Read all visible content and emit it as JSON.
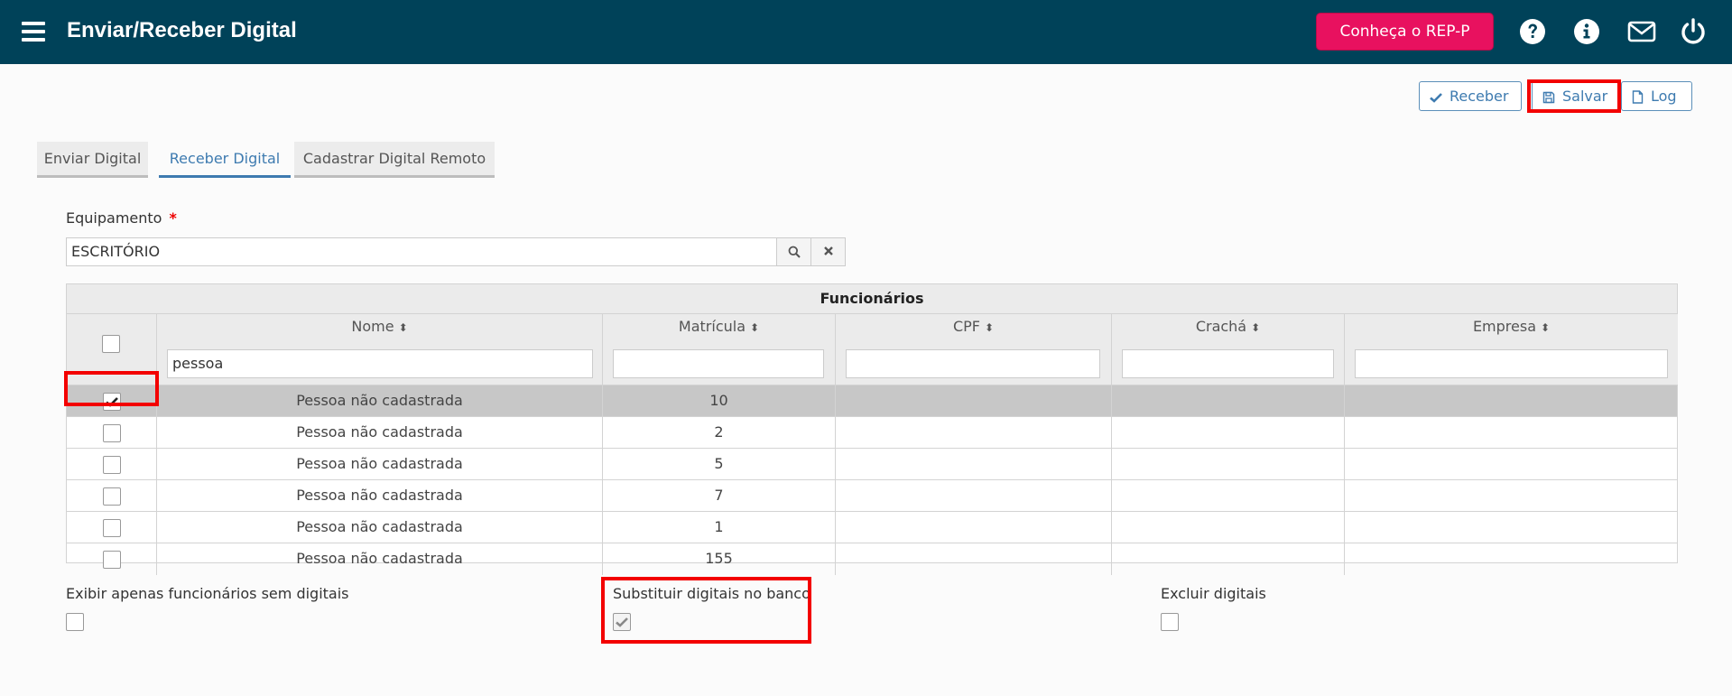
{
  "header": {
    "title": "Enviar/Receber Digital",
    "rep_button": "Conheça o REP-P",
    "icons": [
      "menu-icon",
      "help-icon",
      "info-icon",
      "mail-icon",
      "power-icon"
    ]
  },
  "toolbar": {
    "receber": "Receber",
    "salvar": "Salvar",
    "log": "Log"
  },
  "tabs": [
    {
      "label": "Enviar Digital",
      "active": false
    },
    {
      "label": "Receber Digital",
      "active": true
    },
    {
      "label": "Cadastrar Digital Remoto",
      "active": false
    }
  ],
  "form": {
    "equipamento_label": "Equipamento",
    "required_mark": "*",
    "equipamento_value": "ESCRITÓRIO"
  },
  "table": {
    "caption": "Funcionários",
    "columns": [
      "Nome",
      "Matrícula",
      "CPF",
      "Crachá",
      "Empresa"
    ],
    "filters": {
      "nome": "pessoa",
      "matricula": "",
      "cpf": "",
      "cracha": "",
      "empresa": ""
    },
    "rows": [
      {
        "checked": true,
        "nome": "Pessoa não cadastrada",
        "matricula": "10",
        "cpf": "",
        "cracha": "",
        "empresa": ""
      },
      {
        "checked": false,
        "nome": "Pessoa não cadastrada",
        "matricula": "2",
        "cpf": "",
        "cracha": "",
        "empresa": ""
      },
      {
        "checked": false,
        "nome": "Pessoa não cadastrada",
        "matricula": "5",
        "cpf": "",
        "cracha": "",
        "empresa": ""
      },
      {
        "checked": false,
        "nome": "Pessoa não cadastrada",
        "matricula": "7",
        "cpf": "",
        "cracha": "",
        "empresa": ""
      },
      {
        "checked": false,
        "nome": "Pessoa não cadastrada",
        "matricula": "1",
        "cpf": "",
        "cracha": "",
        "empresa": ""
      },
      {
        "checked": false,
        "nome": "Pessoa não cadastrada",
        "matricula": "155",
        "cpf": "",
        "cracha": "",
        "empresa": ""
      }
    ]
  },
  "options": {
    "exibir_label": "Exibir apenas funcionários sem digitais",
    "exibir_checked": false,
    "substituir_label": "Substituir digitais no banco",
    "substituir_checked": true,
    "excluir_label": "Excluir digitais",
    "excluir_checked": false
  },
  "colors": {
    "header_bg": "#004259",
    "rep_button": "#e8115f",
    "accent_blue": "#3e7bb0",
    "highlight": "#f30000",
    "selected_row": "#c7c7c7"
  }
}
